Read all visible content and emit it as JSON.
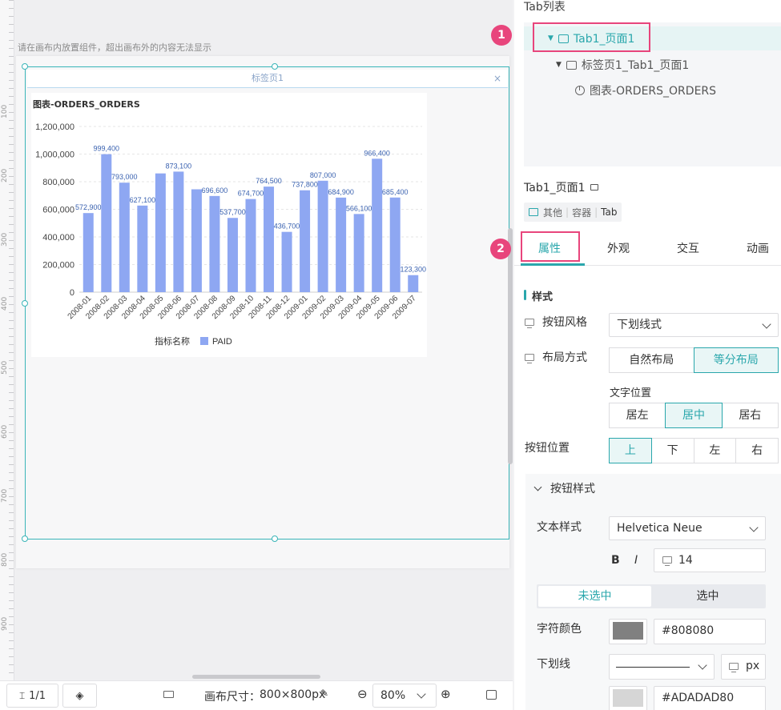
{
  "canvas": {
    "hint": "请在画布内放置组件，超出画布外的内容无法显示",
    "ruler_marks": [
      "100",
      "200",
      "300",
      "400",
      "500",
      "600",
      "700",
      "800",
      "900"
    ],
    "tab_label": "标签页1",
    "tab_close": "×"
  },
  "chart_data": {
    "type": "bar",
    "title": "图表-ORDERS_ORDERS",
    "legend_title": "指标名称",
    "categories": [
      "2008-01",
      "2008-02",
      "2008-03",
      "2008-04",
      "2008-05",
      "2008-06",
      "2008-07",
      "2008-08",
      "2008-09",
      "2008-10",
      "2008-11",
      "2008-12",
      "2009-01",
      "2009-02",
      "2009-03",
      "2009-04",
      "2009-05",
      "2009-06",
      "2009-07"
    ],
    "series": [
      {
        "name": "PAID",
        "values": [
          572900,
          999400,
          793000,
          627100,
          860000,
          873100,
          745000,
          696600,
          537700,
          674700,
          764500,
          436700,
          737800,
          807000,
          684900,
          566100,
          966400,
          685400,
          123300
        ],
        "labels": [
          "572,900",
          "999,400",
          "793,000",
          "627,100",
          "",
          "873,100",
          "",
          "696,600",
          "537,700",
          "674,700",
          "764,500",
          "436,700",
          "737,800",
          "807,000",
          "684,900",
          "566,100",
          "966,400",
          "685,400",
          "123,300"
        ]
      }
    ],
    "yticks": [
      "0",
      "200,000",
      "400,000",
      "600,000",
      "800,000",
      "1,000,000",
      "1,200,000"
    ],
    "ylim": [
      0,
      1200000
    ],
    "color": "#8ea7f2",
    "legend_position": "bottom"
  },
  "bottom_bar": {
    "page": "1/1",
    "canvas_size_label": "画布尺寸：",
    "canvas_size": "800×800px",
    "zoom": "80%"
  },
  "right": {
    "tab_list_title": "Tab列表",
    "tree": [
      {
        "label": "Tab1_页面1"
      },
      {
        "label": "标签页1_Tab1_页面1"
      },
      {
        "label": "图表-ORDERS_ORDERS"
      }
    ],
    "callouts": [
      "1",
      "2"
    ],
    "component_name": "Tab1_页面1",
    "tags": [
      "其他",
      "容器",
      "Tab"
    ],
    "prop_tabs": [
      "属性",
      "外观",
      "交互",
      "动画"
    ],
    "section_style": "样式",
    "button_style_label": "按钮风格",
    "button_style_value": "下划线式",
    "layout_label": "布局方式",
    "layout_options": [
      "自然布局",
      "等分布局"
    ],
    "text_pos_label": "文字位置",
    "text_pos_options": [
      "居左",
      "居中",
      "居右"
    ],
    "btn_pos_label": "按钮位置",
    "btn_pos_options": [
      "上",
      "下",
      "左",
      "右"
    ],
    "btn_style_section": "按钮样式",
    "text_style_label": "文本样式",
    "font_value": "Helvetica Neue",
    "bold": "B",
    "italic": "I",
    "font_size": "14",
    "state_options": [
      "未选中",
      "选中"
    ],
    "char_color_label": "字符颜色",
    "char_color": "#808080",
    "underline_label": "下划线",
    "unit": "px",
    "underline_color": "#ADADAD80"
  }
}
